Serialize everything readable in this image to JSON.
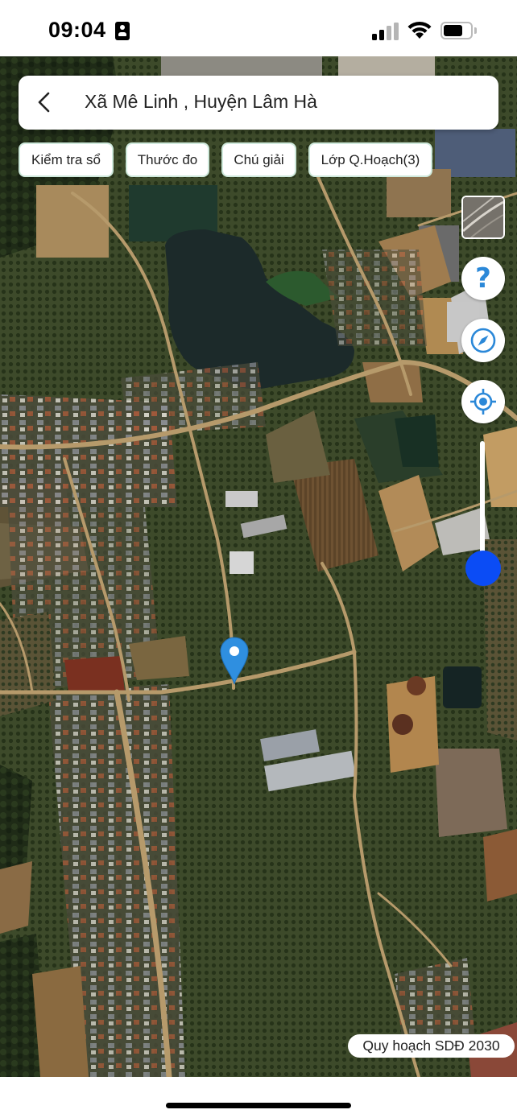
{
  "status_bar": {
    "time": "09:04",
    "icons": [
      "id-card-icon",
      "cellular-signal-icon",
      "wifi-icon",
      "battery-icon"
    ]
  },
  "header": {
    "back_icon": "chevron-left-icon",
    "location_title": "Xã Mê Linh , Huyện Lâm Hà"
  },
  "toolbar": {
    "chips": [
      "Kiểm tra sổ",
      "Thước đo",
      "Chú giải",
      "Lớp Q.Hoạch(3)"
    ]
  },
  "map_controls": {
    "layer_toggle_icon": "map-layer-thumbnail",
    "help_icon": "question-mark-icon",
    "help_glyph": "?",
    "compass_icon": "compass-icon",
    "locate_icon": "my-location-icon",
    "accent_color": "#0b4cf5",
    "icon_color": "#2b88d8"
  },
  "map": {
    "pin_icon": "map-pin-icon",
    "pin_color": "#2f8fe0",
    "planning_label": "Quy hoạch SDĐ 2030"
  }
}
